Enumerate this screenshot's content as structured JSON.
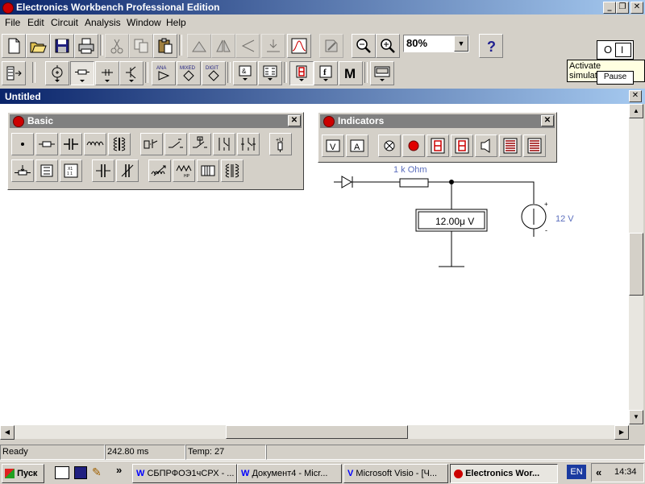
{
  "app": {
    "title": "Electronics Workbench Professional Edition"
  },
  "menu": {
    "items": [
      "File",
      "Edit",
      "Circuit",
      "Analysis",
      "Window",
      "Help"
    ]
  },
  "toolbar": {
    "zoom": "80%",
    "buttons": [
      "new-icon",
      "open-icon",
      "save-icon",
      "print-icon",
      "cut-icon",
      "copy-icon",
      "paste-icon",
      "rotate-icon",
      "flip-horizontal-icon",
      "flip-vertical-icon",
      "subcircuit-icon",
      "graph-icon",
      "component-properties-icon",
      "zoom-out-icon",
      "zoom-in-icon",
      "help-icon"
    ]
  },
  "parts_bin": {
    "buttons": [
      {
        "icon": "favorites-icon"
      },
      {
        "icon": "sources-icon"
      },
      {
        "icon": "basic-icon"
      },
      {
        "icon": "diodes-icon"
      },
      {
        "icon": "transistors-icon"
      },
      {
        "icon": "analog-ics-icon",
        "label": "ANA"
      },
      {
        "icon": "mixed-ics-icon",
        "label": "MIXED"
      },
      {
        "icon": "digital-ics-icon",
        "label": "DIGIT"
      },
      {
        "icon": "logic-gates-icon"
      },
      {
        "icon": "digital-icon"
      },
      {
        "icon": "indicators-icon"
      },
      {
        "icon": "controls-icon",
        "label": "f"
      },
      {
        "icon": "miscellaneous-icon",
        "label": "M"
      },
      {
        "icon": "instruments-icon"
      }
    ]
  },
  "simulation": {
    "switch_label_off": "O",
    "switch_label_on": "I",
    "tooltip": "Activate simulation",
    "pause_label": "Pause"
  },
  "document": {
    "title": "Untitled"
  },
  "basic_palette": {
    "title": "Basic",
    "buttons": [
      "connector-icon",
      "resistor-icon",
      "capacitor-icon",
      "inductor-icon",
      "transformer-icon",
      "relay-icon",
      "switch-icon",
      "time-delay-switch-icon",
      "voltage-controlled-switch-icon",
      "current-controlled-switch-icon",
      "pull-up-resistor-icon",
      "potentiometer-icon",
      "resistor-pack-icon",
      "voltage-controlled-analog-switch-icon",
      "polarized-capacitor-icon",
      "variable-capacitor-icon",
      "variable-inductor-icon",
      "coreless-coil-icon",
      "magnetic-core-icon",
      "nonlinear-transformer-icon"
    ]
  },
  "indicators_palette": {
    "title": "Indicators",
    "buttons": [
      "voltmeter-icon",
      "ammeter-icon",
      "bulb-icon",
      "red-probe-icon",
      "seven-segment-display-icon",
      "decoded-seven-segment-display-icon",
      "buzzer-icon",
      "bargraph-display-icon",
      "decoded-bargraph-display-icon"
    ],
    "voltmeter_letter": "V",
    "ammeter_letter": "A"
  },
  "circuit": {
    "resistor_label": "1 k Ohm",
    "source_label": "12 V",
    "voltmeter_reading": "12.00μ  V",
    "plus": "+",
    "minus": "-"
  },
  "status": {
    "state": "Ready",
    "time": "242.80 ms",
    "temp": "Temp:  27"
  },
  "taskbar": {
    "start_label": "Пуск",
    "quick_launch_more": "»",
    "tasks": [
      {
        "label": "СБПРФОЭ1чСРХ - ..."
      },
      {
        "label": "Документ4 - Micr..."
      },
      {
        "label": "Microsoft Visio - [Ч..."
      },
      {
        "label": "Electronics Wor...",
        "active": true
      }
    ],
    "language": "EN",
    "tray_arrows": "«",
    "clock": "14:34"
  },
  "colors": {
    "titlebar": "#0a246a",
    "label_blue": "#5b6ebd",
    "desktop": "#d4d0c8"
  }
}
